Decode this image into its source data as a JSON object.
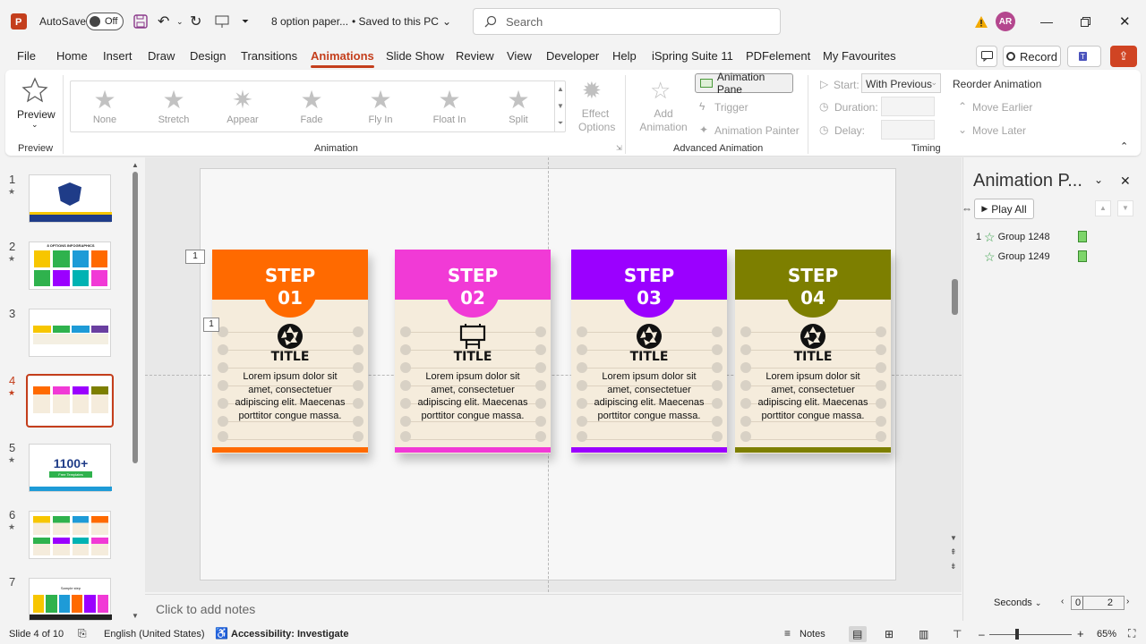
{
  "titlebar": {
    "autosave_label": "AutoSave",
    "autosave_state": "Off",
    "filename": "8 option paper...",
    "save_status": "Saved to this PC",
    "search_placeholder": "Search",
    "user_initials": "AR"
  },
  "menu": {
    "tabs": [
      "File",
      "Home",
      "Insert",
      "Draw",
      "Design",
      "Transitions",
      "Animations",
      "Slide Show",
      "Review",
      "View",
      "Developer",
      "Help",
      "iSpring Suite 11",
      "PDFelement",
      "My Favourites"
    ],
    "active_tab": "Animations",
    "record_label": "Record"
  },
  "ribbon": {
    "preview_label": "Preview",
    "preview_group": "Preview",
    "animation_group": "Animation",
    "animations": [
      "None",
      "Stretch",
      "Appear",
      "Fade",
      "Fly In",
      "Float In",
      "Split"
    ],
    "effect_options": "Effect Options",
    "add_animation": "Add Animation",
    "animation_pane": "Animation Pane",
    "trigger": "Trigger",
    "animation_painter": "Animation Painter",
    "advanced_group": "Advanced Animation",
    "start_label": "Start:",
    "start_value": "With Previous",
    "duration_label": "Duration:",
    "delay_label": "Delay:",
    "timing_group": "Timing",
    "reorder_label": "Reorder Animation",
    "move_earlier": "Move Earlier",
    "move_later": "Move Later"
  },
  "slides": {
    "numbers": [
      "1",
      "2",
      "3",
      "4",
      "5",
      "6",
      "7"
    ],
    "thumb5_text": "1100+",
    "thumb5_sub": "Free Templates",
    "thumb2_title": "8 OPTIONS INFOGRAPHICS",
    "thumb7_title": "Sample step"
  },
  "slide": {
    "tag1": "1",
    "tag2": "1",
    "cards": [
      {
        "step": "STEP",
        "num": "01",
        "title": "TITLE",
        "body": "Lorem ipsum dolor sit amet, consectetuer adipiscing elit. Maecenas porttitor congue massa.",
        "color": "#ff6a00",
        "icon": "aperture-icon"
      },
      {
        "step": "STEP",
        "num": "02",
        "title": "TITLE",
        "body": "Lorem ipsum dolor sit amet, consectetuer adipiscing elit. Maecenas porttitor congue massa.",
        "color": "#f13ad6",
        "icon": "billboard-icon"
      },
      {
        "step": "STEP",
        "num": "03",
        "title": "TITLE",
        "body": "Lorem ipsum dolor sit amet, consectetuer adipiscing elit. Maecenas porttitor congue massa.",
        "color": "#9b00ff",
        "icon": "aperture-icon"
      },
      {
        "step": "STEP",
        "num": "04",
        "title": "TITLE",
        "body": "Lorem ipsum dolor sit amet, consectetuer adipiscing elit. Maecenas porttitor congue massa.",
        "color": "#7d7f00",
        "icon": "aperture-icon"
      }
    ]
  },
  "notes_placeholder": "Click to add notes",
  "pane": {
    "title": "Animation P...",
    "play_all": "Play All",
    "items": [
      {
        "num": "1",
        "name": "Group 1248"
      },
      {
        "num": "",
        "name": "Group 1249"
      }
    ],
    "seconds_label": "Seconds",
    "timeline_start": "0",
    "timeline_end": "2"
  },
  "status": {
    "slide_info": "Slide 4 of 10",
    "language": "English (United States)",
    "accessibility": "Accessibility: Investigate",
    "notes": "Notes",
    "zoom": "65%"
  },
  "colors": {
    "accent": "#c43e1c",
    "ppt_red": "#c43e1c",
    "green_bar": "#5bbf4a"
  }
}
